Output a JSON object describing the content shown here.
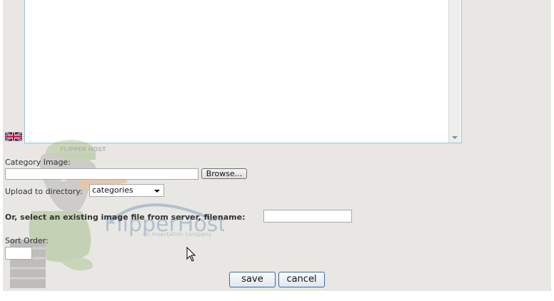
{
  "form": {
    "category_image_label": "Category Image:",
    "browse_label": "Browse...",
    "file_value": "",
    "upload_dir_label": "Upload to directory:",
    "upload_dir_selected": "categories",
    "existing_file_label": "Or, select an existing image file from server, filename:",
    "existing_file_value": "",
    "sort_order_label": "Sort Order:",
    "sort_order_value": ""
  },
  "actions": {
    "save_label": "save",
    "cancel_label": "cancel"
  },
  "watermark": {
    "brand": "FlipperHost",
    "tagline": "an investation company",
    "cap_text": "FLIPPER HOST"
  },
  "icons": {
    "language_flag": "uk-flag-icon",
    "cursor": "mouse-pointer-icon"
  }
}
